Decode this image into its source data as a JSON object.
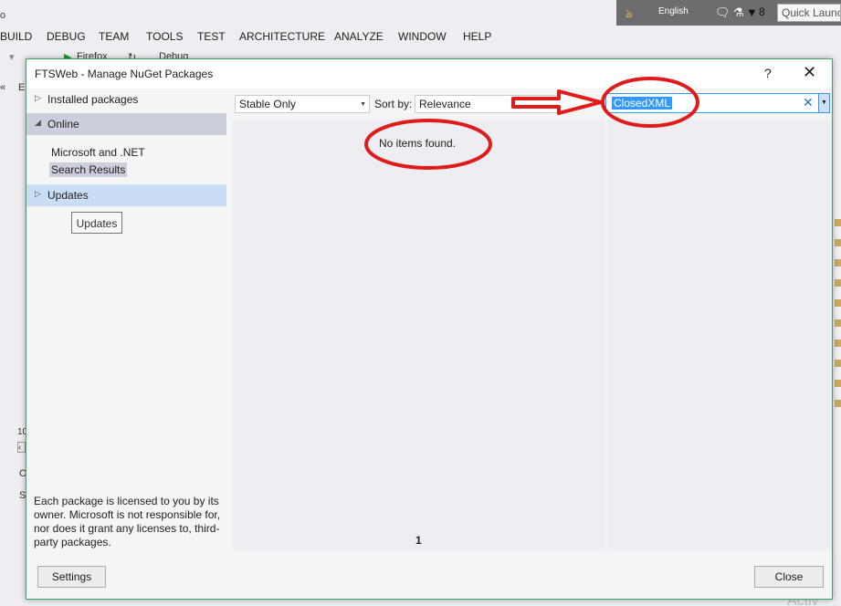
{
  "vs": {
    "title_fragment": "o",
    "launch_strip": {
      "language": "English",
      "notification_count": "8",
      "quick_launch": "Quick Launch"
    },
    "menu": [
      "BUILD",
      "DEBUG",
      "TEAM",
      "TOOLS",
      "TEST",
      "ARCHITECTURE",
      "ANALYZE",
      "WINDOW",
      "HELP"
    ],
    "toolbar": {
      "run_label": "Firefox",
      "config_label": "Debug"
    },
    "left_edge": {
      "tab_fragment": "E",
      "zoom_fragment": "10",
      "output_fragment_1": "O",
      "output_fragment_2": "S"
    },
    "watermark": "Activ"
  },
  "dialog": {
    "title": "FTSWeb - Manage NuGet Packages",
    "help_glyph": "?",
    "close_glyph": "✕",
    "nav": {
      "installed": "Installed packages",
      "online": "Online",
      "online_sub": [
        "Microsoft and .NET",
        "Search Results"
      ],
      "updates": "Updates",
      "tooltip": "Updates"
    },
    "license_text": "Each package is licensed to you by its owner. Microsoft is not responsible for, nor does it grant any licenses to, third-party packages.",
    "filter": {
      "release_filter": "Stable Only",
      "sort_label": "Sort by:",
      "sort_value": "Relevance"
    },
    "search": {
      "value": "ClosedXML",
      "clear_glyph": "✕"
    },
    "results": {
      "empty_message": "No items found.",
      "page": "1"
    },
    "buttons": {
      "settings": "Settings",
      "close": "Close"
    }
  },
  "colors": {
    "accent_border": "#3fa36b",
    "selection_blue": "#3399ff",
    "nav_selected": "#cccedb",
    "nav_hover": "#c9def5",
    "annotation_red": "#e01b1b"
  }
}
